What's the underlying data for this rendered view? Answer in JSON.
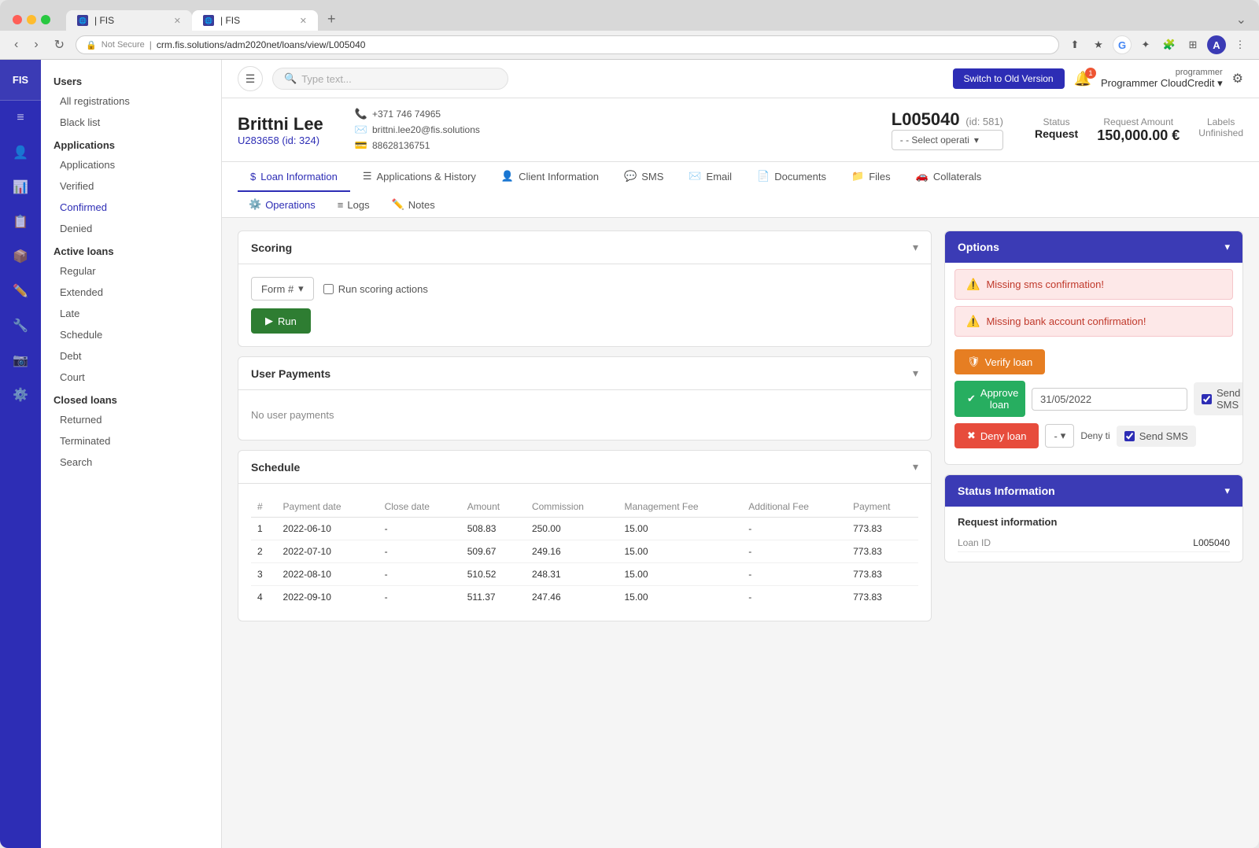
{
  "browser": {
    "tabs": [
      {
        "id": 1,
        "favicon": "🌐",
        "title": "| FIS",
        "active": false
      },
      {
        "id": 2,
        "favicon": "🌐",
        "title": "| FIS",
        "active": true
      }
    ],
    "address": {
      "security": "Not Secure",
      "url": "crm.fis.solutions/adm2020net/loans/view/L005040"
    }
  },
  "header": {
    "search_placeholder": "Type text...",
    "switch_btn": "Switch to Old Version",
    "user_role": "programmer",
    "user_name": "Programmer CloudCredit"
  },
  "sidebar": {
    "logo": "FIS",
    "icons": [
      "≡",
      "👤",
      "📊",
      "📋",
      "📦",
      "✏️",
      "🔧",
      "📷",
      "⚙️"
    ]
  },
  "left_nav": {
    "sections": [
      {
        "title": "Users",
        "items": [
          "All registrations",
          "Black list"
        ]
      },
      {
        "title": "Applications",
        "items": [
          "Applications",
          "Verified",
          "Confirmed",
          "Denied"
        ]
      },
      {
        "title": "Active loans",
        "items": [
          "Regular",
          "Extended",
          "Late",
          "Schedule",
          "Debt",
          "Court"
        ]
      },
      {
        "title": "Closed loans",
        "items": [
          "Returned",
          "Terminated"
        ]
      },
      {
        "title": "",
        "items": [
          "Search"
        ]
      }
    ]
  },
  "client": {
    "name": "Brittni Lee",
    "id": "U283658 (id: 324)",
    "phone": "+371 746 74965",
    "email": "brittni.lee20@fis.solutions",
    "payid": "88628136751"
  },
  "loan": {
    "id": "L005040",
    "db_id": "(id: 581)",
    "select_placeholder": "- - Select operati",
    "status_label": "Status",
    "status_value": "Request",
    "amount_label": "Request Amount",
    "amount_value": "150,000.00 €",
    "labels_label": "Labels",
    "labels_value": "Unfinished"
  },
  "tabs": {
    "main": [
      {
        "id": "loan",
        "label": "Loan Information",
        "icon": "$",
        "active": true
      },
      {
        "id": "history",
        "label": "Applications & History",
        "icon": "☰",
        "active": false
      },
      {
        "id": "client",
        "label": "Client Information",
        "icon": "👤",
        "active": false
      },
      {
        "id": "sms",
        "label": "SMS",
        "icon": "💬",
        "active": false
      },
      {
        "id": "email",
        "label": "Email",
        "icon": "✉️",
        "active": false
      },
      {
        "id": "documents",
        "label": "Documents",
        "icon": "📄",
        "active": false
      },
      {
        "id": "files",
        "label": "Files",
        "icon": "📁",
        "active": false
      },
      {
        "id": "collaterals",
        "label": "Collaterals",
        "icon": "🚗",
        "active": false
      }
    ],
    "sub": [
      {
        "id": "operations",
        "label": "Operations",
        "icon": "⚙️",
        "active": true
      },
      {
        "id": "logs",
        "label": "Logs",
        "icon": "≡",
        "active": false
      },
      {
        "id": "notes",
        "label": "Notes",
        "icon": "✏️",
        "active": false
      }
    ]
  },
  "scoring": {
    "section_title": "Scoring",
    "form_label": "Form #",
    "checkbox_label": "Run scoring actions",
    "run_btn": "Run"
  },
  "user_payments": {
    "section_title": "User Payments",
    "no_payments_text": "No user payments"
  },
  "schedule": {
    "section_title": "Schedule",
    "columns": [
      "#",
      "Payment date",
      "Close date",
      "Amount",
      "Commission",
      "Management Fee",
      "Additional Fee",
      "Payment"
    ],
    "rows": [
      {
        "num": 1,
        "payment_date": "2022-06-10",
        "close_date": "-",
        "amount": "508.83",
        "commission": "250.00",
        "mgmt_fee": "15.00",
        "additional_fee": "-",
        "payment": "773.83"
      },
      {
        "num": 2,
        "payment_date": "2022-07-10",
        "close_date": "-",
        "amount": "509.67",
        "commission": "249.16",
        "mgmt_fee": "15.00",
        "additional_fee": "-",
        "payment": "773.83"
      },
      {
        "num": 3,
        "payment_date": "2022-08-10",
        "close_date": "-",
        "amount": "510.52",
        "commission": "248.31",
        "mgmt_fee": "15.00",
        "additional_fee": "-",
        "payment": "773.83"
      },
      {
        "num": 4,
        "payment_date": "2022-09-10",
        "close_date": "-",
        "amount": "511.37",
        "commission": "247.46",
        "mgmt_fee": "15.00",
        "additional_fee": "-",
        "payment": "773.83"
      }
    ]
  },
  "options": {
    "title": "Options",
    "alerts": [
      {
        "type": "danger",
        "text": "Missing sms confirmation!"
      },
      {
        "type": "danger",
        "text": "Missing bank account confirmation!"
      }
    ],
    "verify_btn": "Verify loan",
    "approve_btn": "Approve loan",
    "approve_date": "31/05/2022",
    "approve_send_sms": "Send SMS",
    "deny_btn": "Deny loan",
    "deny_placeholder": "-",
    "deny_label": "Deny ti",
    "deny_send_sms": "Send SMS"
  },
  "status_info": {
    "title": "Status Information",
    "request_info_title": "Request information",
    "loan_id_label": "Loan ID",
    "loan_id_value": "L005040"
  }
}
